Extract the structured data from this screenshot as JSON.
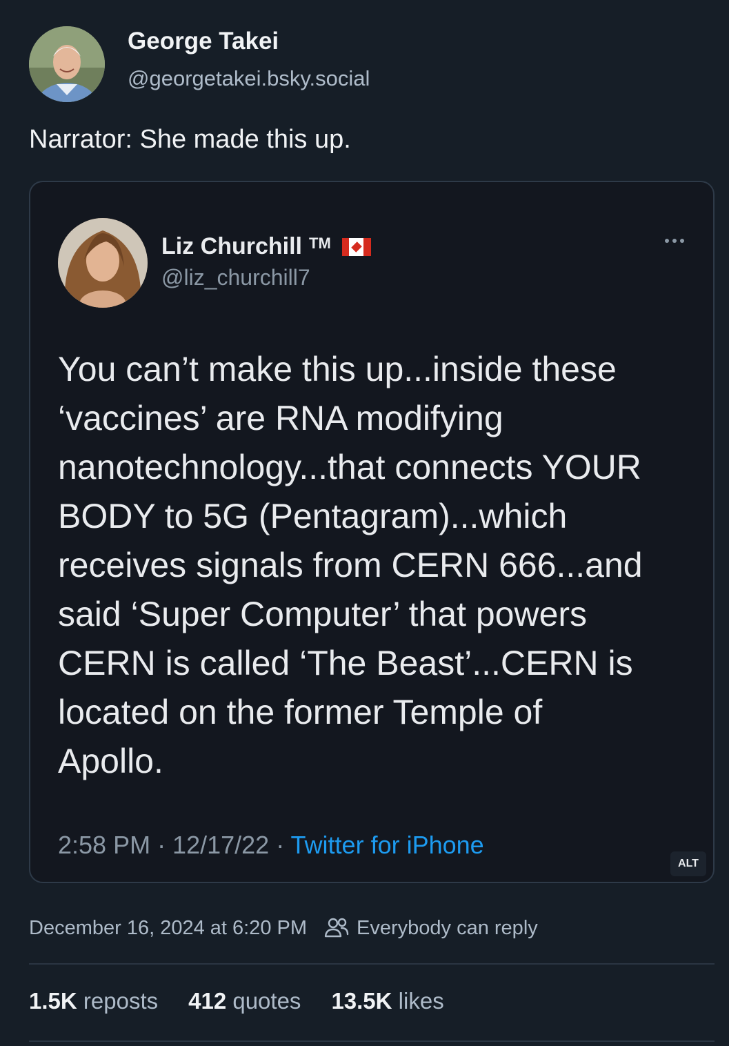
{
  "author": {
    "display_name": "George Takei",
    "handle": "@georgetakei.bsky.social"
  },
  "post": {
    "text": "Narrator: She made this up."
  },
  "embedded_image": {
    "name": "Liz Churchill",
    "tm": "TM",
    "flag": "Canada flag",
    "handle": "@liz_churchill7",
    "text": "You can’t make this up...inside these\n‘vaccines’ are RNA modifying\nnanotechnology...that connects YOUR\nBODY to 5G (Pentagram)...which\nreceives signals from CERN 666...and\nsaid ‘Super Computer’ that powers\nCERN is called ‘The Beast’...CERN is\nlocated on the former Temple of\nApollo.",
    "time": "2:58 PM · 12/17/22 · ",
    "source": "Twitter for iPhone",
    "alt_label": "ALT"
  },
  "meta": {
    "timestamp": "December 16, 2024 at 6:20 PM",
    "reply_setting": "Everybody can reply"
  },
  "stats": {
    "reposts_count": "1.5K",
    "reposts_label": "reposts",
    "quotes_count": "412",
    "quotes_label": "quotes",
    "likes_count": "13.5K",
    "likes_label": "likes"
  },
  "colors": {
    "background": "#161e27",
    "link": "#1d9bf0",
    "muted": "#aebbc9"
  }
}
